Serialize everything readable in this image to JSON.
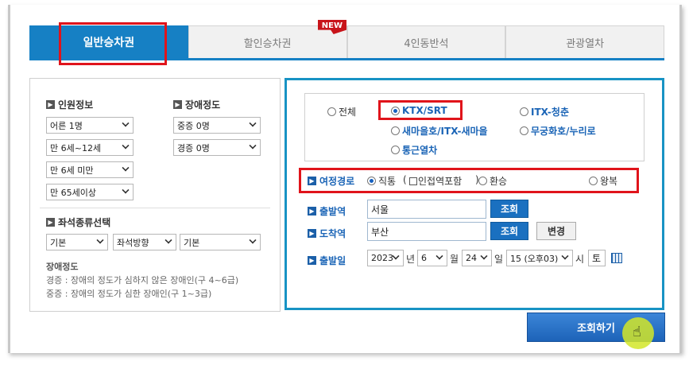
{
  "tabs": [
    {
      "label": "일반승차권",
      "active": true
    },
    {
      "label": "할인승차권",
      "badge": "NEW"
    },
    {
      "label": "4인동반석"
    },
    {
      "label": "관광열차"
    }
  ],
  "passenger": {
    "title": "인원정보",
    "selects": [
      "어른 1명",
      "만 6세~12세",
      "만 6세 미만",
      "만 65세이상"
    ]
  },
  "disability": {
    "title": "장애정도",
    "selects": [
      "중증 0명",
      "경증 0명"
    ]
  },
  "seat": {
    "title": "좌석종류선택",
    "selects": [
      "기본",
      "좌석방향",
      "기본"
    ]
  },
  "disability_note": {
    "title": "장애정도",
    "lines": [
      "경증 : 장애의 정도가 심하지 않은 장애인(구 4~6급)",
      "중증 : 장애의 정도가 심한 장애인(구 1~3급)"
    ]
  },
  "train_types": [
    {
      "label": "전체",
      "selected": false
    },
    {
      "label": "KTX/SRT",
      "selected": true
    },
    {
      "label": "ITX-청춘",
      "selected": false
    },
    {
      "label": "새마을호/ITX-새마을",
      "selected": false
    },
    {
      "label": "무궁화호/누리로",
      "selected": false
    },
    {
      "label": "통근열차",
      "selected": false
    }
  ],
  "route": {
    "label": "여정경로",
    "direct": "직통",
    "paren_open": "(",
    "include_connect": "인접역포함",
    "paren_close": ")",
    "transfer": "환승",
    "round_trip": "왕복"
  },
  "departure": {
    "label": "출발역",
    "value": "서울",
    "search": "조회"
  },
  "arrival": {
    "label": "도착역",
    "value": "부산",
    "search": "조회",
    "change": "변경"
  },
  "date": {
    "label": "출발일",
    "year": "2023",
    "year_unit": "년",
    "month": "6",
    "month_unit": "월",
    "day": "24",
    "day_unit": "일",
    "hour": "15 (오후03)",
    "hour_unit": "시",
    "weekday": "토"
  },
  "submit": "조회하기",
  "colors": {
    "accent": "#1680c4",
    "highlight": "#e0141b",
    "link": "#1a64b6"
  }
}
